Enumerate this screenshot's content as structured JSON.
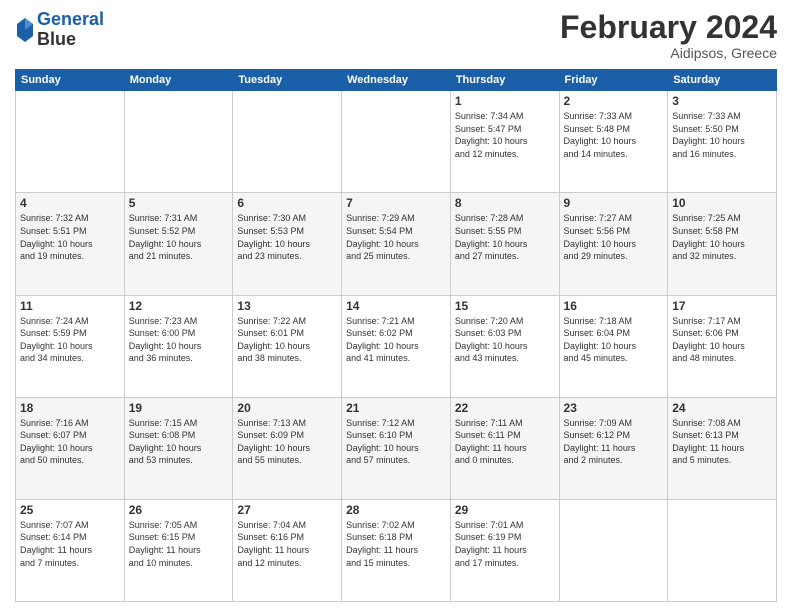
{
  "header": {
    "logo_line1": "General",
    "logo_line2": "Blue",
    "month_title": "February 2024",
    "location": "Aidipsos, Greece"
  },
  "weekdays": [
    "Sunday",
    "Monday",
    "Tuesday",
    "Wednesday",
    "Thursday",
    "Friday",
    "Saturday"
  ],
  "weeks": [
    [
      {
        "day": "",
        "info": ""
      },
      {
        "day": "",
        "info": ""
      },
      {
        "day": "",
        "info": ""
      },
      {
        "day": "",
        "info": ""
      },
      {
        "day": "1",
        "info": "Sunrise: 7:34 AM\nSunset: 5:47 PM\nDaylight: 10 hours\nand 12 minutes."
      },
      {
        "day": "2",
        "info": "Sunrise: 7:33 AM\nSunset: 5:48 PM\nDaylight: 10 hours\nand 14 minutes."
      },
      {
        "day": "3",
        "info": "Sunrise: 7:33 AM\nSunset: 5:50 PM\nDaylight: 10 hours\nand 16 minutes."
      }
    ],
    [
      {
        "day": "4",
        "info": "Sunrise: 7:32 AM\nSunset: 5:51 PM\nDaylight: 10 hours\nand 19 minutes."
      },
      {
        "day": "5",
        "info": "Sunrise: 7:31 AM\nSunset: 5:52 PM\nDaylight: 10 hours\nand 21 minutes."
      },
      {
        "day": "6",
        "info": "Sunrise: 7:30 AM\nSunset: 5:53 PM\nDaylight: 10 hours\nand 23 minutes."
      },
      {
        "day": "7",
        "info": "Sunrise: 7:29 AM\nSunset: 5:54 PM\nDaylight: 10 hours\nand 25 minutes."
      },
      {
        "day": "8",
        "info": "Sunrise: 7:28 AM\nSunset: 5:55 PM\nDaylight: 10 hours\nand 27 minutes."
      },
      {
        "day": "9",
        "info": "Sunrise: 7:27 AM\nSunset: 5:56 PM\nDaylight: 10 hours\nand 29 minutes."
      },
      {
        "day": "10",
        "info": "Sunrise: 7:25 AM\nSunset: 5:58 PM\nDaylight: 10 hours\nand 32 minutes."
      }
    ],
    [
      {
        "day": "11",
        "info": "Sunrise: 7:24 AM\nSunset: 5:59 PM\nDaylight: 10 hours\nand 34 minutes."
      },
      {
        "day": "12",
        "info": "Sunrise: 7:23 AM\nSunset: 6:00 PM\nDaylight: 10 hours\nand 36 minutes."
      },
      {
        "day": "13",
        "info": "Sunrise: 7:22 AM\nSunset: 6:01 PM\nDaylight: 10 hours\nand 38 minutes."
      },
      {
        "day": "14",
        "info": "Sunrise: 7:21 AM\nSunset: 6:02 PM\nDaylight: 10 hours\nand 41 minutes."
      },
      {
        "day": "15",
        "info": "Sunrise: 7:20 AM\nSunset: 6:03 PM\nDaylight: 10 hours\nand 43 minutes."
      },
      {
        "day": "16",
        "info": "Sunrise: 7:18 AM\nSunset: 6:04 PM\nDaylight: 10 hours\nand 45 minutes."
      },
      {
        "day": "17",
        "info": "Sunrise: 7:17 AM\nSunset: 6:06 PM\nDaylight: 10 hours\nand 48 minutes."
      }
    ],
    [
      {
        "day": "18",
        "info": "Sunrise: 7:16 AM\nSunset: 6:07 PM\nDaylight: 10 hours\nand 50 minutes."
      },
      {
        "day": "19",
        "info": "Sunrise: 7:15 AM\nSunset: 6:08 PM\nDaylight: 10 hours\nand 53 minutes."
      },
      {
        "day": "20",
        "info": "Sunrise: 7:13 AM\nSunset: 6:09 PM\nDaylight: 10 hours\nand 55 minutes."
      },
      {
        "day": "21",
        "info": "Sunrise: 7:12 AM\nSunset: 6:10 PM\nDaylight: 10 hours\nand 57 minutes."
      },
      {
        "day": "22",
        "info": "Sunrise: 7:11 AM\nSunset: 6:11 PM\nDaylight: 11 hours\nand 0 minutes."
      },
      {
        "day": "23",
        "info": "Sunrise: 7:09 AM\nSunset: 6:12 PM\nDaylight: 11 hours\nand 2 minutes."
      },
      {
        "day": "24",
        "info": "Sunrise: 7:08 AM\nSunset: 6:13 PM\nDaylight: 11 hours\nand 5 minutes."
      }
    ],
    [
      {
        "day": "25",
        "info": "Sunrise: 7:07 AM\nSunset: 6:14 PM\nDaylight: 11 hours\nand 7 minutes."
      },
      {
        "day": "26",
        "info": "Sunrise: 7:05 AM\nSunset: 6:15 PM\nDaylight: 11 hours\nand 10 minutes."
      },
      {
        "day": "27",
        "info": "Sunrise: 7:04 AM\nSunset: 6:16 PM\nDaylight: 11 hours\nand 12 minutes."
      },
      {
        "day": "28",
        "info": "Sunrise: 7:02 AM\nSunset: 6:18 PM\nDaylight: 11 hours\nand 15 minutes."
      },
      {
        "day": "29",
        "info": "Sunrise: 7:01 AM\nSunset: 6:19 PM\nDaylight: 11 hours\nand 17 minutes."
      },
      {
        "day": "",
        "info": ""
      },
      {
        "day": "",
        "info": ""
      }
    ]
  ]
}
